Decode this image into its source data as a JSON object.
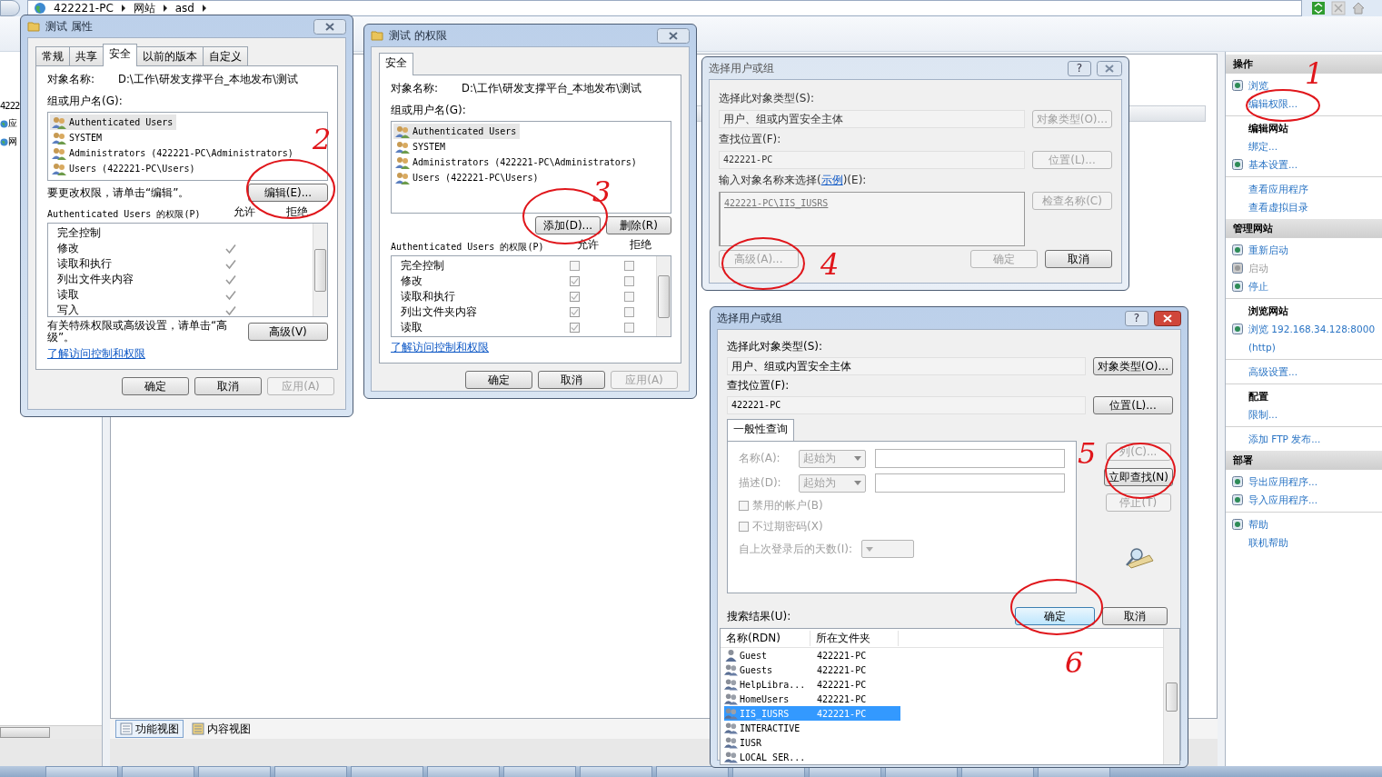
{
  "iis": {
    "breadcrumb": [
      {
        "label": "422221-PC"
      },
      {
        "label": "网站"
      },
      {
        "label": "asd"
      }
    ],
    "tree": [
      {
        "label": "4222",
        "icon": false
      },
      {
        "label": "应",
        "icon": true
      },
      {
        "label": "网",
        "icon": true
      }
    ],
    "view_tabs": [
      {
        "label": "功能视图",
        "selected": true
      },
      {
        "label": "内容视图",
        "selected": false
      }
    ],
    "actions": [
      {
        "title": "操作",
        "groups": [
          [
            {
              "label": "浏览",
              "kind": "link",
              "icon": true,
              "disabled": false
            },
            {
              "label": "编辑权限...",
              "kind": "link",
              "icon": false,
              "disabled": false
            }
          ],
          [
            {
              "label": "编辑网站",
              "kind": "title"
            },
            {
              "label": "绑定...",
              "kind": "link",
              "icon": false,
              "disabled": false
            },
            {
              "label": "基本设置...",
              "kind": "link",
              "icon": true,
              "disabled": false
            }
          ],
          [
            {
              "label": "查看应用程序",
              "kind": "link",
              "icon": false,
              "disabled": false
            },
            {
              "label": "查看虚拟目录",
              "kind": "link",
              "icon": false,
              "disabled": false
            }
          ]
        ]
      },
      {
        "title": "管理网站",
        "groups": [
          [
            {
              "label": "重新启动",
              "kind": "link",
              "icon": true,
              "disabled": false
            },
            {
              "label": "启动",
              "kind": "link",
              "icon": true,
              "disabled": true
            },
            {
              "label": "停止",
              "kind": "link",
              "icon": true,
              "disabled": false
            }
          ],
          [
            {
              "label": "浏览网站",
              "kind": "title"
            },
            {
              "label": "浏览 192.168.34.128:8000 (http)",
              "kind": "link",
              "icon": true,
              "disabled": false
            }
          ],
          [
            {
              "label": "高级设置...",
              "kind": "link",
              "icon": false,
              "disabled": false
            }
          ],
          [
            {
              "label": "配置",
              "kind": "title"
            },
            {
              "label": "限制...",
              "kind": "link",
              "icon": false,
              "disabled": false
            }
          ],
          [
            {
              "label": "添加 FTP 发布...",
              "kind": "link",
              "icon": false,
              "disabled": false
            }
          ]
        ]
      },
      {
        "title": "部署",
        "groups": [
          [
            {
              "label": "导出应用程序...",
              "kind": "link",
              "icon": true,
              "disabled": false
            },
            {
              "label": "导入应用程序...",
              "kind": "link",
              "icon": true,
              "disabled": false
            }
          ],
          [
            {
              "label": "帮助",
              "kind": "link",
              "icon": true,
              "disabled": false
            },
            {
              "label": "联机帮助",
              "kind": "link",
              "icon": false,
              "disabled": false
            }
          ]
        ]
      }
    ]
  },
  "properties_dialog": {
    "title": "测试 属性",
    "tabs": [
      {
        "label": "常规",
        "selected": false
      },
      {
        "label": "共享",
        "selected": false
      },
      {
        "label": "安全",
        "selected": true
      },
      {
        "label": "以前的版本",
        "selected": false
      },
      {
        "label": "自定义",
        "selected": false
      }
    ],
    "object_label": "对象名称:",
    "object_name": "D:\\工作\\研发支撑平台_本地发布\\测试",
    "groups_label": "组或用户名(G):",
    "users": [
      {
        "name": "Authenticated Users",
        "selected": true
      },
      {
        "name": "SYSTEM",
        "selected": false
      },
      {
        "name": "Administrators (422221-PC\\Administrators)",
        "selected": false
      },
      {
        "name": "Users (422221-PC\\Users)",
        "selected": false
      }
    ],
    "edit_hint": "要更改权限，请单击“编辑”。",
    "edit_button": "编辑(E)...",
    "perm_title": "Authenticated Users 的权限(P)",
    "allow_label": "允许",
    "deny_label": "拒绝",
    "permissions": [
      {
        "name": "完全控制",
        "allow": false,
        "deny": false
      },
      {
        "name": "修改",
        "allow": true,
        "deny": false
      },
      {
        "name": "读取和执行",
        "allow": true,
        "deny": false
      },
      {
        "name": "列出文件夹内容",
        "allow": true,
        "deny": false
      },
      {
        "name": "读取",
        "allow": true,
        "deny": false
      },
      {
        "name": "写入",
        "allow": true,
        "deny": false
      }
    ],
    "advanced_hint": "有关特殊权限或高级设置，请单击“高级”。",
    "advanced_button": "高级(V)",
    "link": "了解访问控制和权限",
    "buttons": [
      {
        "label": "确定",
        "disabled": false
      },
      {
        "label": "取消",
        "disabled": false
      },
      {
        "label": "应用(A)",
        "disabled": true
      }
    ]
  },
  "permissions_dialog": {
    "title": "测试 的权限",
    "tabs": [
      {
        "label": "安全",
        "selected": true
      }
    ],
    "object_label": "对象名称:",
    "object_name": "D:\\工作\\研发支撑平台_本地发布\\测试",
    "groups_label": "组或用户名(G):",
    "users": [
      {
        "name": "Authenticated Users",
        "selected": true
      },
      {
        "name": "SYSTEM",
        "selected": false
      },
      {
        "name": "Administrators (422221-PC\\Administrators)",
        "selected": false
      },
      {
        "name": "Users (422221-PC\\Users)",
        "selected": false
      }
    ],
    "add_button": "添加(D)...",
    "remove_button": "删除(R)",
    "perm_title": "Authenticated Users 的权限(P)",
    "allow_label": "允许",
    "deny_label": "拒绝",
    "permissions": [
      {
        "name": "完全控制",
        "allow": false,
        "deny": false
      },
      {
        "name": "修改",
        "allow": true,
        "deny": false
      },
      {
        "name": "读取和执行",
        "allow": true,
        "deny": false
      },
      {
        "name": "列出文件夹内容",
        "allow": true,
        "deny": false
      },
      {
        "name": "读取",
        "allow": true,
        "deny": false
      }
    ],
    "link": "了解访问控制和权限",
    "buttons": [
      {
        "label": "确定",
        "disabled": false
      },
      {
        "label": "取消",
        "disabled": false
      },
      {
        "label": "应用(A)",
        "disabled": true
      }
    ]
  },
  "select_dialog": {
    "title": "选择用户或组",
    "help_button": "?",
    "type_label": "选择此对象类型(S):",
    "type_value": "用户、组或内置安全主体",
    "type_button": {
      "label": "对象类型(O)...",
      "disabled": true
    },
    "location_label": "查找位置(F):",
    "location_value": "422221-PC",
    "location_button": {
      "label": "位置(L)...",
      "disabled": true
    },
    "names_label_before": "输入对象名称来选择(",
    "names_link": "示例",
    "names_label_after": ")(E):",
    "names_value": "422221-PC\\IIS_IUSRS",
    "check_button": {
      "label": "检查名称(C)",
      "disabled": true
    },
    "advanced_button": {
      "label": "高级(A)...",
      "disabled": true
    },
    "ok_button": {
      "label": "确定",
      "disabled": true
    },
    "cancel_button": {
      "label": "取消",
      "disabled": false
    }
  },
  "advanced_dialog": {
    "title": "选择用户或组",
    "help_button": "?",
    "type_label": "选择此对象类型(S):",
    "type_value": "用户、组或内置安全主体",
    "type_button": "对象类型(O)...",
    "location_label": "查找位置(F):",
    "location_value": "422221-PC",
    "location_button": "位置(L)...",
    "query_tab": "一般性查询",
    "fields": [
      {
        "label": "名称(A):",
        "operator": "起始为",
        "disabled": true
      },
      {
        "label": "描述(D):",
        "operator": "起始为",
        "disabled": true
      }
    ],
    "checkboxes": [
      {
        "label": "禁用的帐户(B)",
        "checked": false,
        "disabled": true
      },
      {
        "label": "不过期密码(X)",
        "checked": false,
        "disabled": true
      }
    ],
    "days_label": "自上次登录后的天数(I):",
    "side_buttons": [
      {
        "label": "列(C)...",
        "disabled": true
      },
      {
        "label": "立即查找(N)",
        "disabled": false
      },
      {
        "label": "停止(T)",
        "disabled": true
      }
    ],
    "ok_button": "确定",
    "cancel_button": "取消",
    "results_label": "搜索结果(U):",
    "columns": [
      "名称(RDN)",
      "所在文件夹"
    ],
    "rows": [
      {
        "name": "Guest",
        "folder": "422221-PC",
        "kind": "user",
        "selected": false
      },
      {
        "name": "Guests",
        "folder": "422221-PC",
        "kind": "group",
        "selected": false
      },
      {
        "name": "HelpLibra...",
        "folder": "422221-PC",
        "kind": "group",
        "selected": false
      },
      {
        "name": "HomeUsers",
        "folder": "422221-PC",
        "kind": "group",
        "selected": false
      },
      {
        "name": "IIS_IUSRS",
        "folder": "422221-PC",
        "kind": "group",
        "selected": true
      },
      {
        "name": "INTERACTIVE",
        "kind": "group",
        "selected": false
      },
      {
        "name": "IUSR",
        "kind": "group",
        "selected": false
      },
      {
        "name": "LOCAL SER...",
        "kind": "group",
        "selected": false
      }
    ]
  },
  "annotations": [
    {
      "label": "1"
    },
    {
      "label": "2"
    },
    {
      "label": "3"
    },
    {
      "label": "4"
    },
    {
      "label": "5"
    },
    {
      "label": "6"
    }
  ]
}
